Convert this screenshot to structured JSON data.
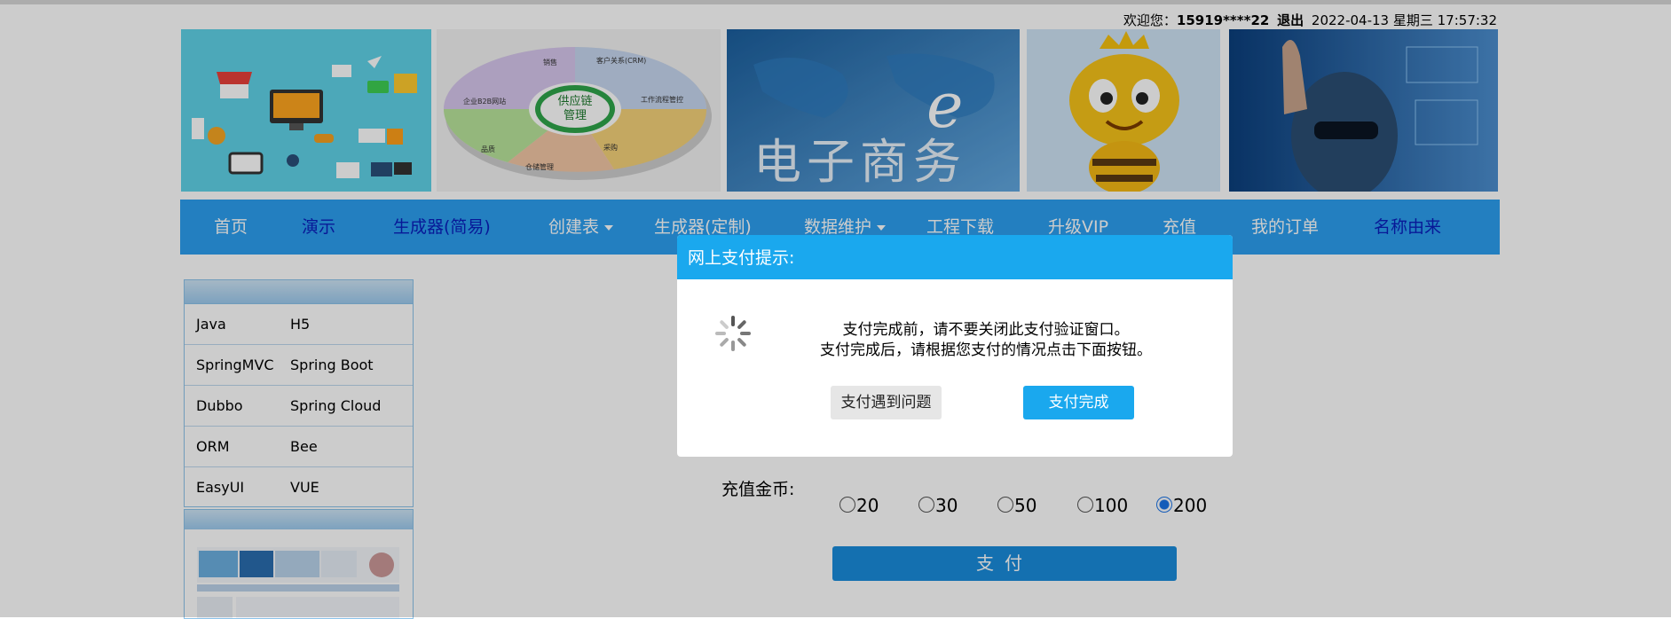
{
  "header": {
    "welcome_prefix": "欢迎您：",
    "username": "15919****22",
    "logout_label": "退出",
    "datetime": "2022-04-13 星期三 17:57:32"
  },
  "banner": {
    "ecommerce_text": "电子商务",
    "supply_chain_text": "供应链管理",
    "crm_text": "客户关系(CRM)",
    "workflow_text": "工作流程管控",
    "b2b_text": "企业B2B网站",
    "sales_text": "销售",
    "purchase_text": "采购",
    "warehouse_text": "仓储管理",
    "quality_text": "品质"
  },
  "nav": {
    "items": [
      {
        "label": "首页",
        "dropdown": false
      },
      {
        "label": "演示",
        "dropdown": false
      },
      {
        "label": "生成器(简易)",
        "dropdown": false
      },
      {
        "label": "创建表",
        "dropdown": true
      },
      {
        "label": "生成器(定制)",
        "dropdown": false
      },
      {
        "label": "数据维护",
        "dropdown": true
      },
      {
        "label": "工程下载",
        "dropdown": false
      },
      {
        "label": "升级VIP",
        "dropdown": false
      },
      {
        "label": "充值",
        "dropdown": false
      },
      {
        "label": "我的订单",
        "dropdown": false
      },
      {
        "label": "名称由来",
        "dropdown": false
      }
    ]
  },
  "sidemenu": {
    "rows": [
      [
        "Java",
        "H5"
      ],
      [
        "SpringMVC",
        "Spring Boot"
      ],
      [
        "Dubbo",
        "Spring Cloud"
      ],
      [
        "ORM",
        "Bee"
      ],
      [
        "EasyUI",
        "VUE"
      ]
    ]
  },
  "recharge": {
    "label": "充值金币:",
    "options": [
      "20",
      "30",
      "50",
      "100",
      "200"
    ],
    "selected": "200",
    "pay_label": "支付"
  },
  "modal": {
    "title": "网上支付提示:",
    "message_line1": "支付完成前，请不要关闭此支付验证窗口。",
    "message_line2": "支付完成后，请根据您支付的情况点击下面按钮。",
    "problem_button": "支付遇到问题",
    "done_button": "支付完成"
  },
  "colors": {
    "nav_bg": "#2c9ff0",
    "modal_header": "#1aa8ee",
    "pay_button": "#1a8ddc"
  }
}
